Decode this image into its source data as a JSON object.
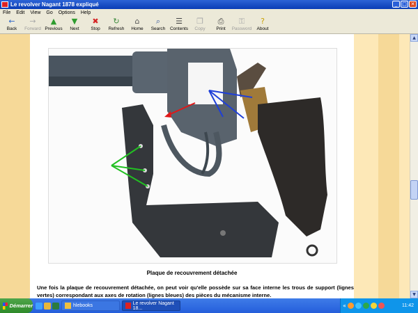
{
  "window": {
    "title": "Le revolver Nagant 1878 expliqué",
    "controls": [
      "_",
      "□",
      "✕"
    ]
  },
  "menu": [
    "File",
    "Edit",
    "View",
    "Go",
    "Options",
    "Help"
  ],
  "toolbar": [
    {
      "label": "Back",
      "icon": "←",
      "icon_name": "back-arrow-icon",
      "color": "#2a64c8",
      "disabled": false
    },
    {
      "label": "Forward",
      "icon": "→",
      "icon_name": "forward-arrow-icon",
      "color": "#a9a9a9",
      "disabled": true
    },
    {
      "label": "Previous",
      "icon": "▲",
      "icon_name": "previous-arrow-icon",
      "color": "#2e9c2e",
      "disabled": false
    },
    {
      "label": "Next",
      "icon": "▼",
      "icon_name": "next-arrow-icon",
      "color": "#2e9c2e",
      "disabled": false
    },
    {
      "label": "Stop",
      "icon": "✖",
      "icon_name": "stop-icon",
      "color": "#d52424",
      "disabled": false
    },
    {
      "label": "Refresh",
      "icon": "↻",
      "icon_name": "refresh-icon",
      "color": "#3b8a3b",
      "disabled": false
    },
    {
      "label": "Home",
      "icon": "⌂",
      "icon_name": "home-icon",
      "color": "#555555",
      "disabled": false
    },
    {
      "label": "Search",
      "icon": "⌕",
      "icon_name": "search-icon",
      "color": "#335599",
      "disabled": false
    },
    {
      "label": "Contents",
      "icon": "☰",
      "icon_name": "contents-icon",
      "color": "#444444",
      "disabled": false
    },
    {
      "label": "Copy",
      "icon": "❐",
      "icon_name": "copy-icon",
      "color": "#a9a9a9",
      "disabled": true
    },
    {
      "label": "Print",
      "icon": "⎙",
      "icon_name": "print-icon",
      "color": "#444444",
      "disabled": false
    },
    {
      "label": "Password",
      "icon": "⚿",
      "icon_name": "key-icon",
      "color": "#a9a9a9",
      "disabled": true
    },
    {
      "label": "About",
      "icon": "?",
      "icon_name": "about-icon",
      "color": "#c9a000",
      "disabled": false
    }
  ],
  "page": {
    "caption": "Plaque de recouvrement détachée",
    "paragraph": "Une fois la plaque de recouvrement détachée, on peut voir qu'elle possède sur sa face interne les trous de support (lignes vertes) correspondant aux axes de rotation (lignes bleues) des pièces du mécanisme interne."
  },
  "colors": {
    "content_bg": "#fde8b7",
    "band": "#f6d998",
    "green_lines": "#22c022",
    "blue_lines": "#1f3fd8",
    "red_arrow": "#e01818"
  },
  "taskbar": {
    "start_label": "Démarrer",
    "tasks": [
      {
        "label": "hlebooks",
        "active": false
      },
      {
        "label": "Le revolver Nagant 18...",
        "active": true
      }
    ],
    "clock": "11:42",
    "tray_expand": "«"
  }
}
